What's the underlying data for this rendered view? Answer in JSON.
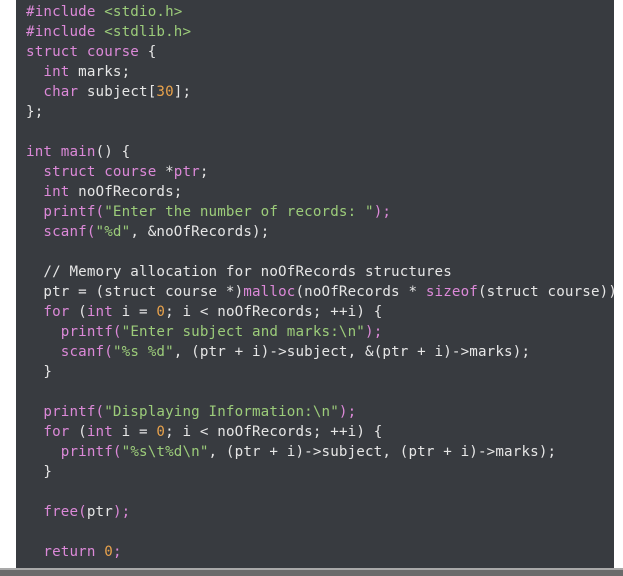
{
  "editor": {
    "theme_colors": {
      "background": "#383b40",
      "keyword": "#dc89d8",
      "string": "#9ccc7a",
      "number": "#e8a24c",
      "text": "#e6e6e6"
    },
    "lines": [
      [
        {
          "t": "#include ",
          "c": "k"
        },
        {
          "t": "<stdio.h>",
          "c": "s"
        }
      ],
      [
        {
          "t": "#include ",
          "c": "k"
        },
        {
          "t": "<stdlib.h>",
          "c": "s"
        }
      ],
      [
        {
          "t": "struct course",
          "c": "k"
        },
        {
          "t": " {",
          "c": "f"
        }
      ],
      [
        {
          "t": "  ",
          "c": "f"
        },
        {
          "t": "int",
          "c": "k"
        },
        {
          "t": " marks;",
          "c": "f"
        }
      ],
      [
        {
          "t": "  ",
          "c": "f"
        },
        {
          "t": "char",
          "c": "k"
        },
        {
          "t": " subject[",
          "c": "f"
        },
        {
          "t": "30",
          "c": "n"
        },
        {
          "t": "];",
          "c": "f"
        }
      ],
      [
        {
          "t": "};",
          "c": "f"
        }
      ],
      [],
      [
        {
          "t": "int",
          "c": "k"
        },
        {
          "t": " ",
          "c": "f"
        },
        {
          "t": "main",
          "c": "k"
        },
        {
          "t": "() {",
          "c": "f"
        }
      ],
      [
        {
          "t": "  ",
          "c": "f"
        },
        {
          "t": "struct course",
          "c": "k"
        },
        {
          "t": " *",
          "c": "f"
        },
        {
          "t": "ptr",
          "c": "k"
        },
        {
          "t": ";",
          "c": "f"
        }
      ],
      [
        {
          "t": "  ",
          "c": "f"
        },
        {
          "t": "int",
          "c": "k"
        },
        {
          "t": " noOfRecords;",
          "c": "f"
        }
      ],
      [
        {
          "t": "  ",
          "c": "f"
        },
        {
          "t": "printf(",
          "c": "k"
        },
        {
          "t": "\"Enter the number of records: \"",
          "c": "s"
        },
        {
          "t": ");",
          "c": "k"
        }
      ],
      [
        {
          "t": "  ",
          "c": "f"
        },
        {
          "t": "scanf(",
          "c": "k"
        },
        {
          "t": "\"%d\"",
          "c": "s"
        },
        {
          "t": ", &noOfRecords);",
          "c": "f"
        }
      ],
      [],
      [
        {
          "t": "  // Memory allocation for noOfRecords structures",
          "c": "f"
        }
      ],
      [
        {
          "t": "  ptr = (struct course *)",
          "c": "f"
        },
        {
          "t": "malloc",
          "c": "k"
        },
        {
          "t": "(noOfRecords * ",
          "c": "f"
        },
        {
          "t": "sizeof",
          "c": "k"
        },
        {
          "t": "(struct course));",
          "c": "f"
        }
      ],
      [
        {
          "t": "  ",
          "c": "f"
        },
        {
          "t": "for",
          "c": "k"
        },
        {
          "t": " (",
          "c": "f"
        },
        {
          "t": "int",
          "c": "k"
        },
        {
          "t": " i = ",
          "c": "f"
        },
        {
          "t": "0",
          "c": "n"
        },
        {
          "t": "; i < noOfRecords; ++i) {",
          "c": "f"
        }
      ],
      [
        {
          "t": "    ",
          "c": "f"
        },
        {
          "t": "printf(",
          "c": "k"
        },
        {
          "t": "\"Enter subject and marks:\\n\"",
          "c": "s"
        },
        {
          "t": ");",
          "c": "k"
        }
      ],
      [
        {
          "t": "    ",
          "c": "f"
        },
        {
          "t": "scanf(",
          "c": "k"
        },
        {
          "t": "\"%s %d\"",
          "c": "s"
        },
        {
          "t": ", (ptr + i)->subject, &(ptr + i)->marks);",
          "c": "f"
        }
      ],
      [
        {
          "t": "  }",
          "c": "f"
        }
      ],
      [],
      [
        {
          "t": "  ",
          "c": "f"
        },
        {
          "t": "printf(",
          "c": "k"
        },
        {
          "t": "\"Displaying Information:\\n\"",
          "c": "s"
        },
        {
          "t": ");",
          "c": "k"
        }
      ],
      [
        {
          "t": "  ",
          "c": "f"
        },
        {
          "t": "for",
          "c": "k"
        },
        {
          "t": " (",
          "c": "f"
        },
        {
          "t": "int",
          "c": "k"
        },
        {
          "t": " i = ",
          "c": "f"
        },
        {
          "t": "0",
          "c": "n"
        },
        {
          "t": "; i < noOfRecords; ++i) {",
          "c": "f"
        }
      ],
      [
        {
          "t": "    ",
          "c": "f"
        },
        {
          "t": "printf(",
          "c": "k"
        },
        {
          "t": "\"%s\\t%d\\n\"",
          "c": "s"
        },
        {
          "t": ", (ptr + i)->subject, (ptr + i)->marks);",
          "c": "f"
        }
      ],
      [
        {
          "t": "  }",
          "c": "f"
        }
      ],
      [],
      [
        {
          "t": "  ",
          "c": "f"
        },
        {
          "t": "free(",
          "c": "k"
        },
        {
          "t": "ptr",
          "c": "f"
        },
        {
          "t": ");",
          "c": "k"
        }
      ],
      [],
      [
        {
          "t": "  ",
          "c": "f"
        },
        {
          "t": "return",
          "c": "k"
        },
        {
          "t": " ",
          "c": "f"
        },
        {
          "t": "0",
          "c": "n"
        },
        {
          "t": ";",
          "c": "k"
        }
      ]
    ]
  }
}
